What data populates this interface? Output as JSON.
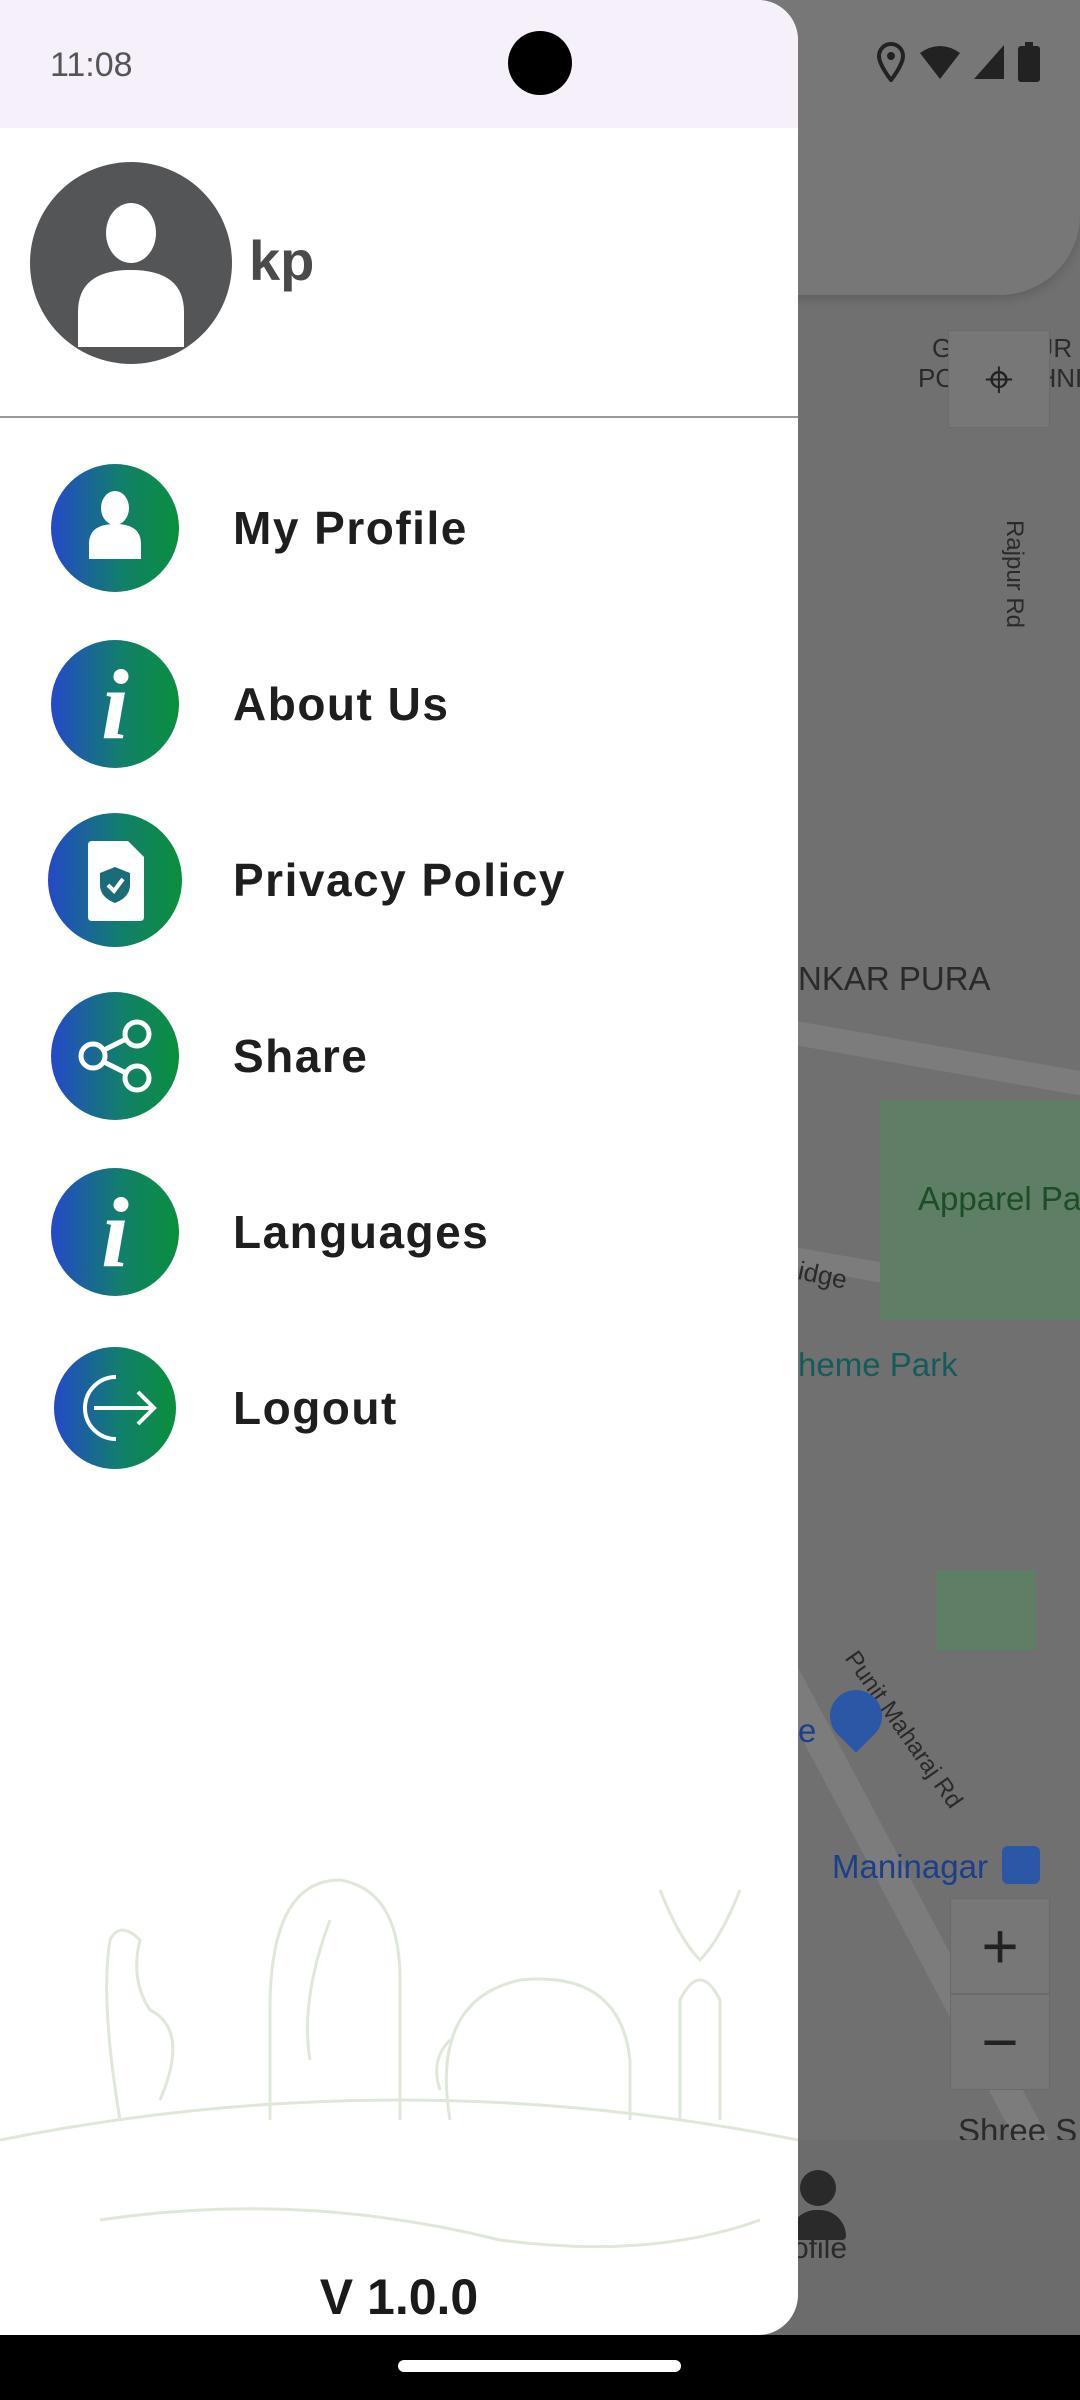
{
  "status_bar": {
    "time": "11:08",
    "icons": [
      "location-icon",
      "wifi-icon",
      "signal-icon",
      "battery-icon"
    ]
  },
  "user": {
    "name": "kp"
  },
  "menu": [
    {
      "label": "My Profile",
      "icon": "person-icon"
    },
    {
      "label": "About Us",
      "icon": "info-icon"
    },
    {
      "label": "Privacy Policy",
      "icon": "privacy-document-icon"
    },
    {
      "label": "Share",
      "icon": "share-icon"
    },
    {
      "label": "Languages",
      "icon": "info-icon"
    },
    {
      "label": "Logout",
      "icon": "logout-icon"
    }
  ],
  "version": "V 1.0.0",
  "map": {
    "labels": [
      "GOMTIPUR",
      "POLYTECHNIC",
      "Rajpur Rd",
      "NKAR PURA",
      "Apparel Pa",
      "idge",
      "heme Park",
      "Punit Maharaj Rd",
      "Maninagar",
      "Shree S",
      "e"
    ],
    "zoom_in": "+",
    "zoom_out": "−",
    "nav_label": "ofile"
  },
  "colors": {
    "gradient_start": "#2449c8",
    "gradient_end": "#0a8f3c",
    "status_bar_bg": "#f6f0fb"
  }
}
